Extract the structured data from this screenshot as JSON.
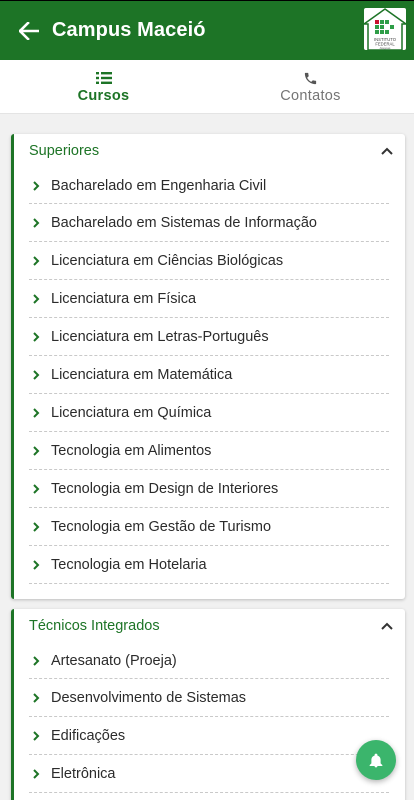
{
  "appbar": {
    "title": "Campus Maceió",
    "logo_text": [
      "INSTITUTO",
      "FEDERAL",
      "Alagoas"
    ]
  },
  "tabs": [
    {
      "label": "Cursos",
      "icon": "list-icon",
      "active": true
    },
    {
      "label": "Contatos",
      "icon": "phone-icon",
      "active": false
    }
  ],
  "sections": [
    {
      "title": "Superiores",
      "items": [
        "Bacharelado em Engenharia Civil",
        "Bacharelado em Sistemas de Informação",
        "Licenciatura em Ciências Biológicas",
        "Licenciatura em Física",
        "Licenciatura em Letras-Português",
        "Licenciatura em Matemática",
        "Licenciatura em Química",
        "Tecnologia em Alimentos",
        "Tecnologia em Design de Interiores",
        "Tecnologia em Gestão de Turismo",
        "Tecnologia em Hotelaria"
      ]
    },
    {
      "title": "Técnicos Integrados",
      "items": [
        "Artesanato (Proeja)",
        "Desenvolvimento de Sistemas",
        "Edificações",
        "Eletrônica"
      ]
    }
  ],
  "colors": {
    "primary": "#1d7426",
    "fab": "#3bb56c"
  }
}
